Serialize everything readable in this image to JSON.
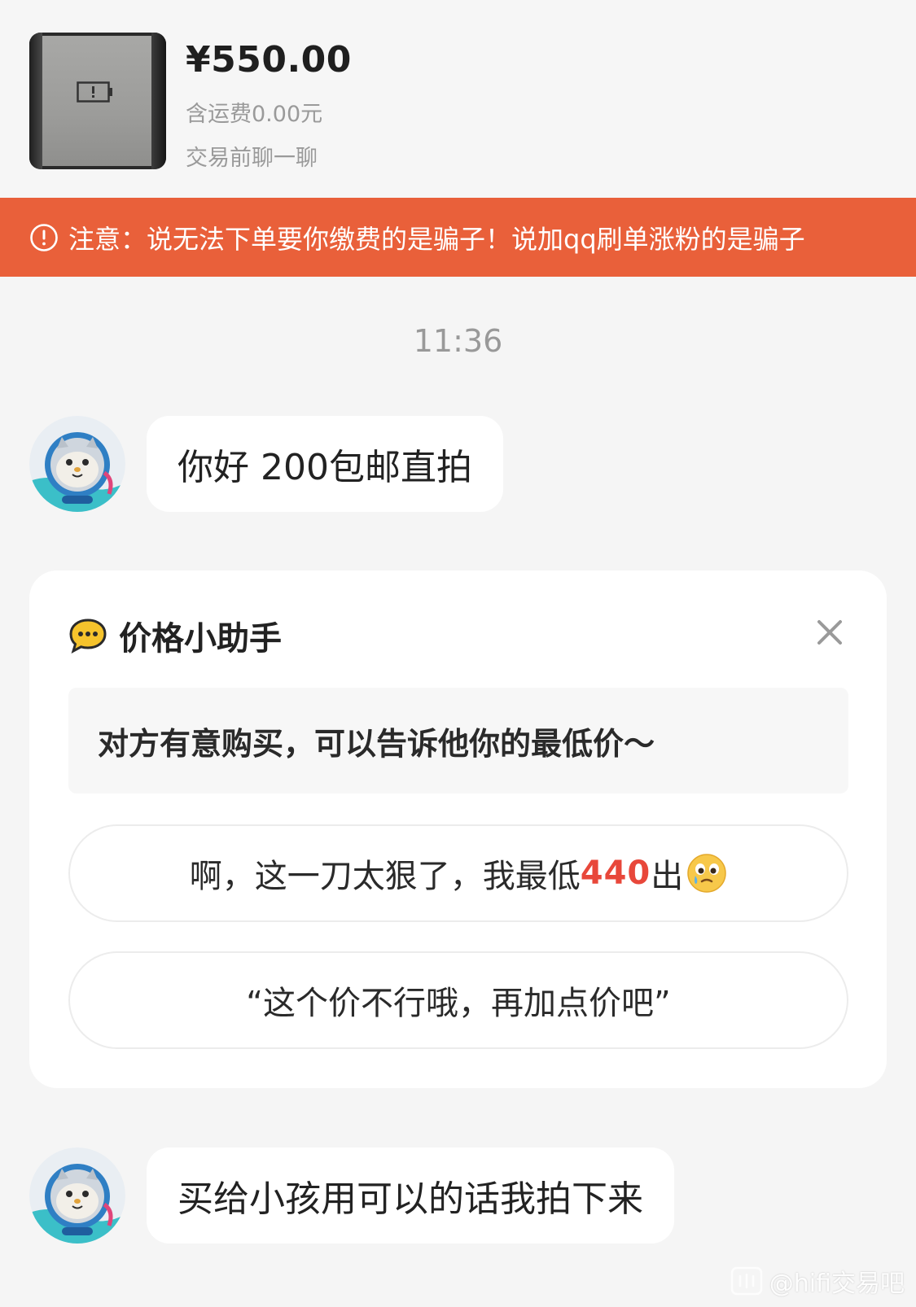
{
  "product": {
    "price": "¥550.00",
    "shipping": "含运费0.00元",
    "chat_note": "交易前聊一聊"
  },
  "warning": {
    "text": "注意：说无法下单要你缴费的是骗子！说加qq刷单涨粉的是骗子"
  },
  "timestamp": "11:36",
  "messages": [
    {
      "text": "你好 200包邮直拍"
    },
    {
      "text": "买给小孩用可以的话我拍下来"
    }
  ],
  "price_helper": {
    "title": "价格小助手",
    "tip": "对方有意购买，可以告诉他你的最低价～",
    "option1": {
      "prefix": "啊，这一刀太狠了，我最低",
      "price": "440",
      "suffix": "出"
    },
    "option2": "“这个价不行哦，再加点价吧”"
  },
  "watermark": "@hifi交易吧",
  "colors": {
    "warning_bg": "#e9603a",
    "highlight_price": "#e8473a",
    "page_bg": "#f5f5f5"
  },
  "icons": {
    "warning": "exclamation-circle-icon",
    "helper": "speech-bubble-icon",
    "close": "close-icon",
    "emoji": "crying-face-emoji",
    "avatar": "cat-astronaut-avatar"
  }
}
